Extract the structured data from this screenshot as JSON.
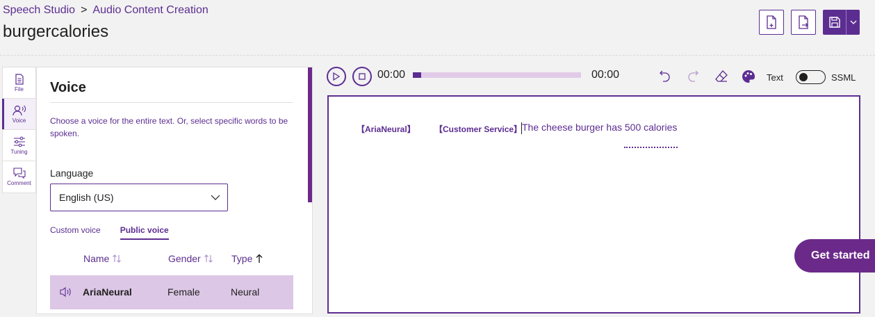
{
  "breadcrumb": {
    "root": "Speech Studio",
    "separator": ">",
    "current": "Audio Content Creation"
  },
  "page_title": "burgercalories",
  "top_actions": [
    "new-file-icon",
    "export-file-icon",
    "save-icon",
    "chevron-down-icon"
  ],
  "side_tabs": [
    {
      "label": "File",
      "icon": "file-icon"
    },
    {
      "label": "Voice",
      "icon": "voice-icon",
      "active": true
    },
    {
      "label": "Tuning",
      "icon": "tuning-icon"
    },
    {
      "label": "Comment",
      "icon": "comment-icon"
    }
  ],
  "voice_panel": {
    "title": "Voice",
    "description": "Choose a voice for the entire text. Or, select specific words to be spoken.",
    "language_label": "Language",
    "language_value": "English (US)",
    "tabs": {
      "custom": "Custom voice",
      "public": "Public voice"
    },
    "columns": {
      "name": "Name",
      "gender": "Gender",
      "type": "Type"
    },
    "selected_voice": {
      "name": "AriaNeural",
      "gender": "Female",
      "type": "Neural"
    }
  },
  "player": {
    "time_current": "00:00",
    "time_total": "00:00",
    "progress": 0.05
  },
  "modes": {
    "text": "Text",
    "ssml": "SSML"
  },
  "editor": {
    "voice_tag": "【AriaNeural】",
    "style_tag": "【Customer Service】",
    "content": "The cheese burger has 500 calories"
  },
  "get_started": "Get started",
  "colors": {
    "accent": "#5c2d91",
    "selected_row": "#dcc7e6",
    "cta": "#6b2a8a"
  }
}
